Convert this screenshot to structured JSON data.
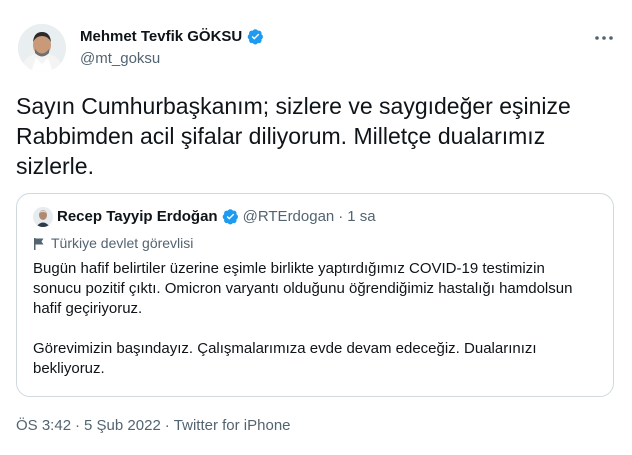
{
  "author": {
    "display_name": "Mehmet Tevfik GÖKSU",
    "handle": "@mt_goksu",
    "verified": true
  },
  "tweet": {
    "text_lines": [
      "Sayın Cumhurbaşkanım; sizlere ve saygıdeğer eşinize",
      "Rabbimden acil şifalar diliyorum. Milletçe dualarımız",
      "sizlerle."
    ]
  },
  "quoted_tweet": {
    "display_name": "Recep Tayyip Erdoğan",
    "handle": "@RTErdogan",
    "separator": "·",
    "time": "1 sa",
    "label": "Türkiye devlet görevlisi",
    "paragraph1_lines": [
      "Bugün hafif belirtiler üzerine eşimle birlikte yaptırdığımız COVID-19 testimizin",
      "sonucu pozitif çıktı. Omicron varyantı olduğunu öğrendiğimiz hastalığı hamdolsun",
      "hafif geçiriyoruz."
    ],
    "paragraph2_lines": [
      "Görevimizin başındayız. Çalışmalarımıza evde devam edeceğiz. Dualarınızı",
      "bekliyoruz."
    ]
  },
  "meta": {
    "time": "ÖS 3:42",
    "separator": "·",
    "date": "5 Şub 2022",
    "source": "Twitter for iPhone"
  },
  "colors": {
    "text": "#0f1419",
    "secondary": "#536471",
    "verified_blue": "#1d9bf0",
    "border": "#cfd9de"
  },
  "icons": {
    "verified": "verified-badge-icon",
    "more": "more-options-icon",
    "flag": "flag-icon"
  }
}
